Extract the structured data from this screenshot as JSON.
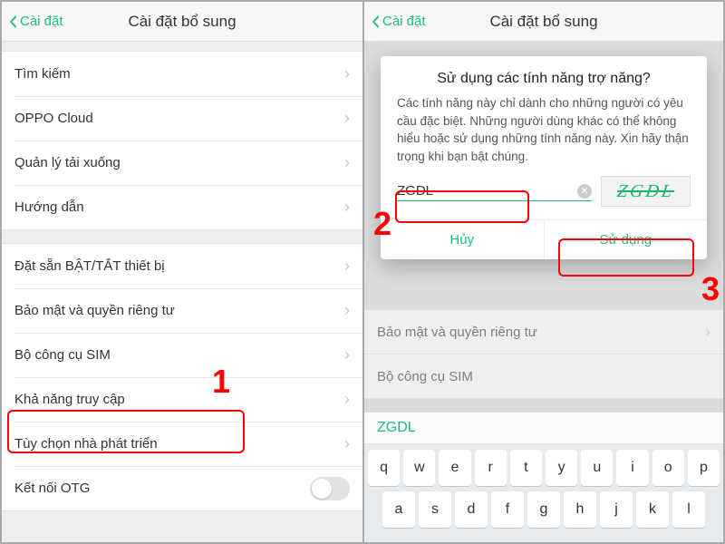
{
  "left": {
    "back": "Cài đặt",
    "title": "Cài đặt bổ sung",
    "group1": [
      {
        "label": "Tìm kiếm"
      },
      {
        "label": "OPPO Cloud"
      },
      {
        "label": "Quản lý tải xuống"
      },
      {
        "label": "Hướng dẫn"
      }
    ],
    "group2": [
      {
        "label": "Đặt sẵn BẬT/TẮT thiết bị"
      },
      {
        "label": "Bảo mật và quyền riêng tư"
      },
      {
        "label": "Bộ công cụ SIM"
      },
      {
        "label": "Khả năng truy cập"
      },
      {
        "label": "Tùy chọn nhà phát triển"
      },
      {
        "label": "Kết nối OTG",
        "toggle": true
      }
    ],
    "annot1": "1"
  },
  "right": {
    "back": "Cài đặt",
    "title": "Cài đặt bổ sung",
    "bgRows": [
      "Bảo mật và quyền riêng tư",
      "Bộ công cụ SIM"
    ],
    "dialog": {
      "title": "Sử dụng các tính năng trợ năng?",
      "body": "Các tính năng này chỉ dành cho những người có yêu cầu đặc biệt. Những người dùng khác có thể không hiểu hoặc sử dụng những tính năng này. Xin hãy thận trọng khi bạn bật chúng.",
      "inputValue": "ZGDL",
      "captcha": "ZGDL",
      "cancel": "Hủy",
      "ok": "Sử dụng"
    },
    "keyboard": {
      "suggestion": "ZGDL",
      "rows": [
        [
          "q",
          "w",
          "e",
          "r",
          "t",
          "y",
          "u",
          "i",
          "o",
          "p"
        ],
        [
          "a",
          "s",
          "d",
          "f",
          "g",
          "h",
          "j",
          "k",
          "l"
        ]
      ]
    },
    "annot2": "2",
    "annot3": "3"
  }
}
